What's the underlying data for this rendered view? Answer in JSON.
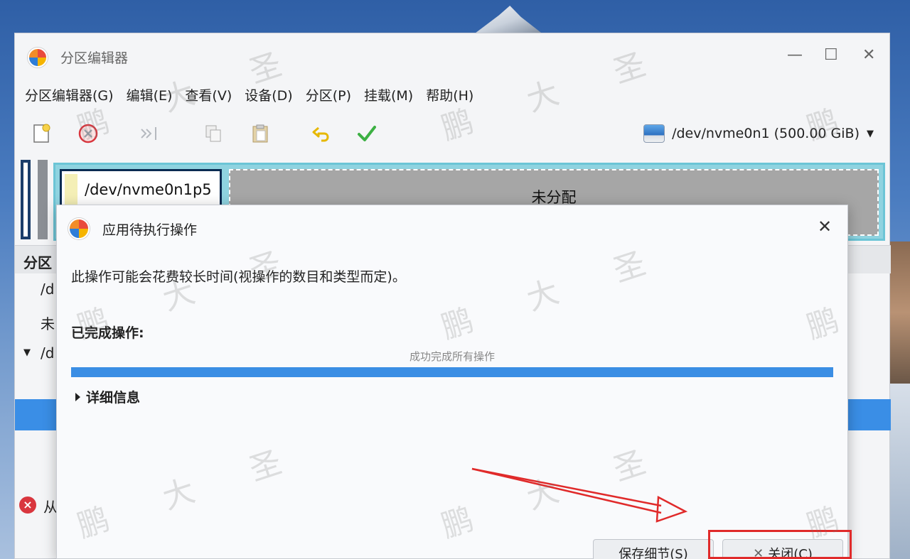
{
  "window": {
    "title": "分区编辑器",
    "controls": {
      "minimize": "—",
      "maximize": "☐",
      "close": "✕"
    }
  },
  "menubar": {
    "items": [
      "分区编辑器(G)",
      "编辑(E)",
      "查看(V)",
      "设备(D)",
      "分区(P)",
      "挂载(M)",
      "帮助(H)"
    ]
  },
  "toolbar": {
    "icons": [
      "new-icon",
      "delete-icon",
      "resize-icon",
      "copy-icon",
      "paste-icon",
      "undo-icon",
      "apply-icon"
    ],
    "device_selector": "/dev/nvme0n1 (500.00 GiB)"
  },
  "partition_graph": {
    "selected_partition": "/dev/nvme0n1p5",
    "unallocated_label": "未分配"
  },
  "partition_list": {
    "header": "分区",
    "rows": [
      "/d",
      "未",
      "/d"
    ]
  },
  "status": {
    "text": "从"
  },
  "dialog": {
    "title": "应用待执行操作",
    "close": "✕",
    "description": "此操作可能会花费较长时间(视操作的数目和类型而定)。",
    "completed_label": "已完成操作:",
    "progress_status": "成功完成所有操作",
    "progress": 1.0,
    "details_toggle": "详细信息",
    "save_button": "保存细节(S)",
    "close_button": "关闭(C)"
  },
  "watermark": [
    "鹏",
    "大",
    "圣"
  ],
  "colors": {
    "accent": "#3b8ee4",
    "selected_row": "#3a8ee6",
    "annotation": "#e02a2a",
    "unallocated": "#a6a6a6",
    "partition_border": "#6cc5d6"
  }
}
